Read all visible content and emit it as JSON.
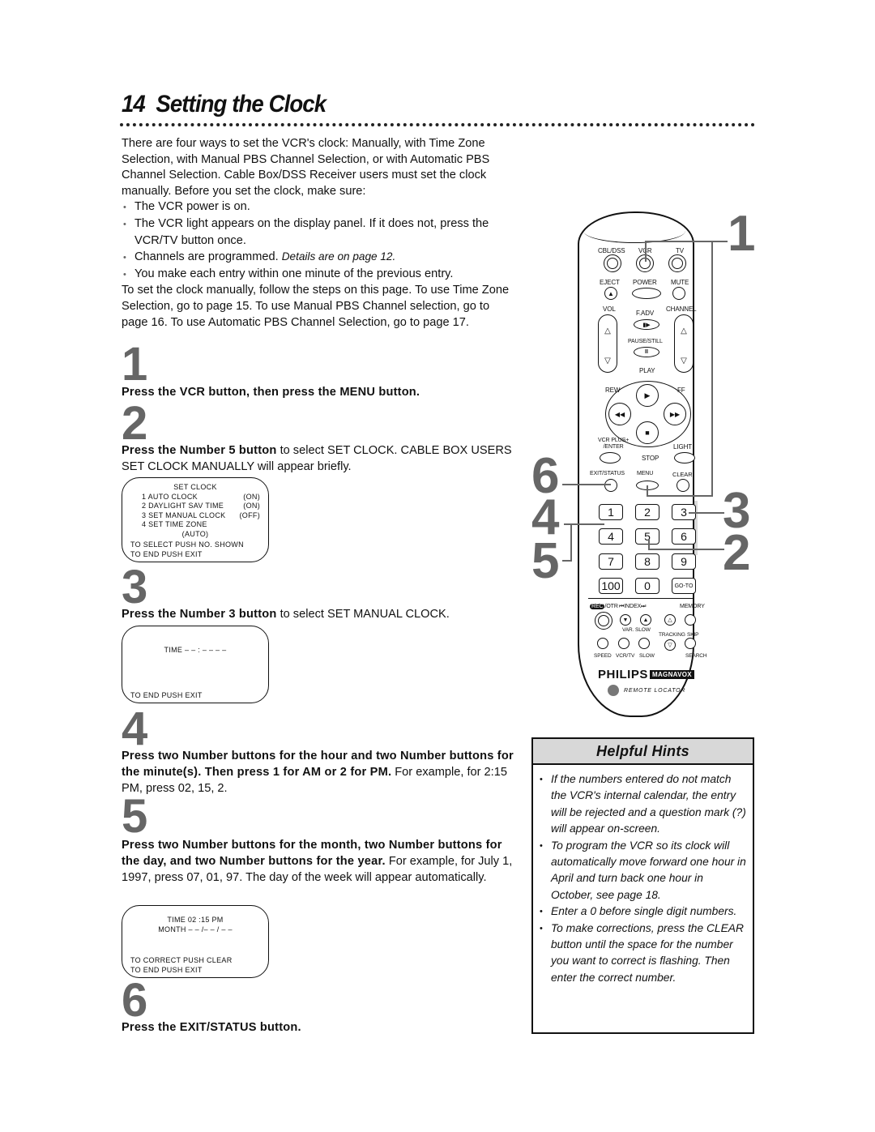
{
  "page": {
    "number": "14",
    "title": "Setting the Clock"
  },
  "intro": {
    "paragraph1": "There are four ways to set the VCR's clock: Manually, with Time Zone Selection, with Manual PBS Channel Selection, or with Automatic PBS Channel Selection. Cable Box/DSS Receiver users must set the clock manually. Before you set the clock, make sure:",
    "bullets": [
      {
        "text": "The VCR power is on.",
        "note": ""
      },
      {
        "text": "The VCR light appears on the display panel. If it does not, press the VCR/TV button once.",
        "note": ""
      },
      {
        "text": "Channels are programmed. ",
        "note": "Details are on page 12."
      },
      {
        "text": "You make each entry within one minute of the previous entry.",
        "note": ""
      }
    ],
    "paragraph2": "To set the clock manually, follow the steps on this page. To use Time Zone Selection, go to page 15. To use Manual PBS Channel selection, go to page 16. To use Automatic PBS Channel Selection, go to page 17."
  },
  "steps": [
    {
      "number": "1",
      "bold": "Press the VCR button, then press the MENU button.",
      "rest": ""
    },
    {
      "number": "2",
      "bold": "Press the Number 5 button",
      "rest": " to select SET CLOCK. CABLE BOX USERS SET CLOCK MANUALLY will appear briefly."
    },
    {
      "number": "3",
      "bold": "Press the Number 3 button",
      "rest": " to select SET MANUAL CLOCK."
    },
    {
      "number": "4",
      "bold": "Press two Number buttons for the hour and two Number buttons for the minute(s). Then press 1 for AM or 2 for PM.",
      "rest": " For example, for 2:15 PM, press 02, 15, 2."
    },
    {
      "number": "5",
      "bold": "Press two Number buttons for the month, two Number buttons for the day, and two Number buttons for the year.",
      "rest": " For example, for July 1, 1997, press 07, 01, 97. The day of the week will appear automatically."
    },
    {
      "number": "6",
      "bold": "Press the EXIT/STATUS button.",
      "rest": ""
    }
  ],
  "screens": {
    "set_clock": {
      "title": "SET CLOCK",
      "items": [
        {
          "label": "1  AUTO CLOCK",
          "value": "(ON)"
        },
        {
          "label": "2  DAYLIGHT SAV TIME",
          "value": "(ON)"
        },
        {
          "label": "3  SET MANUAL CLOCK",
          "value": "(OFF)"
        },
        {
          "label": "4  SET TIME ZONE",
          "value": ""
        }
      ],
      "sub_value": "(AUTO)",
      "footer1": "TO SELECT PUSH NO. SHOWN",
      "footer2": "TO END PUSH EXIT"
    },
    "manual_time": {
      "time_line": "TIME  – – : – –  – –",
      "footer": "TO END PUSH EXIT"
    },
    "date_entry": {
      "time_line": "TIME  02 :15 PM",
      "month_line": "MONTH  – – /– – / – –",
      "footer1": "TO CORRECT PUSH CLEAR",
      "footer2": "TO END PUSH EXIT"
    }
  },
  "remote": {
    "labels": {
      "cbl_dss": "CBL/DSS",
      "vcr": "VCR",
      "tv": "TV",
      "eject": "EJECT",
      "power": "POWER",
      "mute": "MUTE",
      "vol": "VOL",
      "f_adv": "F.ADV",
      "channel": "CHANNEL",
      "pause_still": "PAUSE/STILL",
      "play": "PLAY",
      "rew": "REW",
      "ff": "FF",
      "vcr_plus": "VCR PLUS+",
      "enter": "/ENTER",
      "stop": "STOP",
      "light": "LIGHT",
      "exit_status": "EXIT/STATUS",
      "menu": "MENU",
      "clear": "CLEAR",
      "rec": "REC",
      "otr": "/OTR",
      "index": "⏮INDEX⏭",
      "memory": "MEMORY",
      "var_slow": "VAR. SLOW",
      "tracking": "TRACKING",
      "skip": "SKIP",
      "speed": "SPEED",
      "vcr_tv": "VCR/TV",
      "slow": "SLOW",
      "search": "SEARCH",
      "brand1": "PHILIPS",
      "brand2": "MAGNAVOX",
      "locator": "REMOTE LOCATOR"
    },
    "keypad": [
      "1",
      "2",
      "3",
      "4",
      "5",
      "6",
      "7",
      "8",
      "9",
      "100",
      "0",
      "GO-TO"
    ],
    "callouts": [
      "1",
      "6",
      "4",
      "5",
      "3",
      "2"
    ]
  },
  "hints": {
    "title": "Helpful Hints",
    "items": [
      "If the numbers entered do not match the VCR's internal calendar, the entry will be rejected and a question mark (?) will appear on-screen.",
      "To program the VCR so its clock will automatically move forward one hour in April and turn back one hour in October, see page 18.",
      "Enter a 0 before single digit numbers.",
      "To make corrections, press the CLEAR button until the space for the number you want to correct is flashing. Then enter the correct number."
    ]
  }
}
